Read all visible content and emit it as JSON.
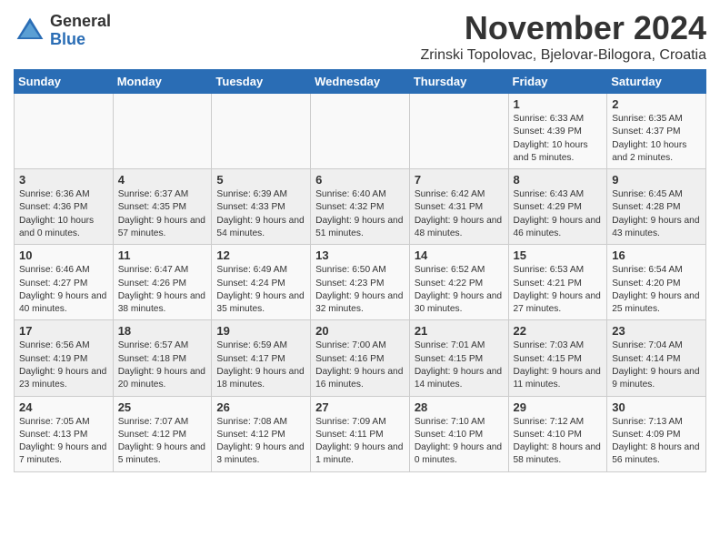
{
  "logo": {
    "general": "General",
    "blue": "Blue"
  },
  "title": {
    "month": "November 2024",
    "location": "Zrinski Topolovac, Bjelovar-Bilogora, Croatia"
  },
  "weekdays": [
    "Sunday",
    "Monday",
    "Tuesday",
    "Wednesday",
    "Thursday",
    "Friday",
    "Saturday"
  ],
  "weeks": [
    [
      {
        "day": "",
        "info": ""
      },
      {
        "day": "",
        "info": ""
      },
      {
        "day": "",
        "info": ""
      },
      {
        "day": "",
        "info": ""
      },
      {
        "day": "",
        "info": ""
      },
      {
        "day": "1",
        "info": "Sunrise: 6:33 AM\nSunset: 4:39 PM\nDaylight: 10 hours and 5 minutes."
      },
      {
        "day": "2",
        "info": "Sunrise: 6:35 AM\nSunset: 4:37 PM\nDaylight: 10 hours and 2 minutes."
      }
    ],
    [
      {
        "day": "3",
        "info": "Sunrise: 6:36 AM\nSunset: 4:36 PM\nDaylight: 10 hours and 0 minutes."
      },
      {
        "day": "4",
        "info": "Sunrise: 6:37 AM\nSunset: 4:35 PM\nDaylight: 9 hours and 57 minutes."
      },
      {
        "day": "5",
        "info": "Sunrise: 6:39 AM\nSunset: 4:33 PM\nDaylight: 9 hours and 54 minutes."
      },
      {
        "day": "6",
        "info": "Sunrise: 6:40 AM\nSunset: 4:32 PM\nDaylight: 9 hours and 51 minutes."
      },
      {
        "day": "7",
        "info": "Sunrise: 6:42 AM\nSunset: 4:31 PM\nDaylight: 9 hours and 48 minutes."
      },
      {
        "day": "8",
        "info": "Sunrise: 6:43 AM\nSunset: 4:29 PM\nDaylight: 9 hours and 46 minutes."
      },
      {
        "day": "9",
        "info": "Sunrise: 6:45 AM\nSunset: 4:28 PM\nDaylight: 9 hours and 43 minutes."
      }
    ],
    [
      {
        "day": "10",
        "info": "Sunrise: 6:46 AM\nSunset: 4:27 PM\nDaylight: 9 hours and 40 minutes."
      },
      {
        "day": "11",
        "info": "Sunrise: 6:47 AM\nSunset: 4:26 PM\nDaylight: 9 hours and 38 minutes."
      },
      {
        "day": "12",
        "info": "Sunrise: 6:49 AM\nSunset: 4:24 PM\nDaylight: 9 hours and 35 minutes."
      },
      {
        "day": "13",
        "info": "Sunrise: 6:50 AM\nSunset: 4:23 PM\nDaylight: 9 hours and 32 minutes."
      },
      {
        "day": "14",
        "info": "Sunrise: 6:52 AM\nSunset: 4:22 PM\nDaylight: 9 hours and 30 minutes."
      },
      {
        "day": "15",
        "info": "Sunrise: 6:53 AM\nSunset: 4:21 PM\nDaylight: 9 hours and 27 minutes."
      },
      {
        "day": "16",
        "info": "Sunrise: 6:54 AM\nSunset: 4:20 PM\nDaylight: 9 hours and 25 minutes."
      }
    ],
    [
      {
        "day": "17",
        "info": "Sunrise: 6:56 AM\nSunset: 4:19 PM\nDaylight: 9 hours and 23 minutes."
      },
      {
        "day": "18",
        "info": "Sunrise: 6:57 AM\nSunset: 4:18 PM\nDaylight: 9 hours and 20 minutes."
      },
      {
        "day": "19",
        "info": "Sunrise: 6:59 AM\nSunset: 4:17 PM\nDaylight: 9 hours and 18 minutes."
      },
      {
        "day": "20",
        "info": "Sunrise: 7:00 AM\nSunset: 4:16 PM\nDaylight: 9 hours and 16 minutes."
      },
      {
        "day": "21",
        "info": "Sunrise: 7:01 AM\nSunset: 4:15 PM\nDaylight: 9 hours and 14 minutes."
      },
      {
        "day": "22",
        "info": "Sunrise: 7:03 AM\nSunset: 4:15 PM\nDaylight: 9 hours and 11 minutes."
      },
      {
        "day": "23",
        "info": "Sunrise: 7:04 AM\nSunset: 4:14 PM\nDaylight: 9 hours and 9 minutes."
      }
    ],
    [
      {
        "day": "24",
        "info": "Sunrise: 7:05 AM\nSunset: 4:13 PM\nDaylight: 9 hours and 7 minutes."
      },
      {
        "day": "25",
        "info": "Sunrise: 7:07 AM\nSunset: 4:12 PM\nDaylight: 9 hours and 5 minutes."
      },
      {
        "day": "26",
        "info": "Sunrise: 7:08 AM\nSunset: 4:12 PM\nDaylight: 9 hours and 3 minutes."
      },
      {
        "day": "27",
        "info": "Sunrise: 7:09 AM\nSunset: 4:11 PM\nDaylight: 9 hours and 1 minute."
      },
      {
        "day": "28",
        "info": "Sunrise: 7:10 AM\nSunset: 4:10 PM\nDaylight: 9 hours and 0 minutes."
      },
      {
        "day": "29",
        "info": "Sunrise: 7:12 AM\nSunset: 4:10 PM\nDaylight: 8 hours and 58 minutes."
      },
      {
        "day": "30",
        "info": "Sunrise: 7:13 AM\nSunset: 4:09 PM\nDaylight: 8 hours and 56 minutes."
      }
    ]
  ]
}
